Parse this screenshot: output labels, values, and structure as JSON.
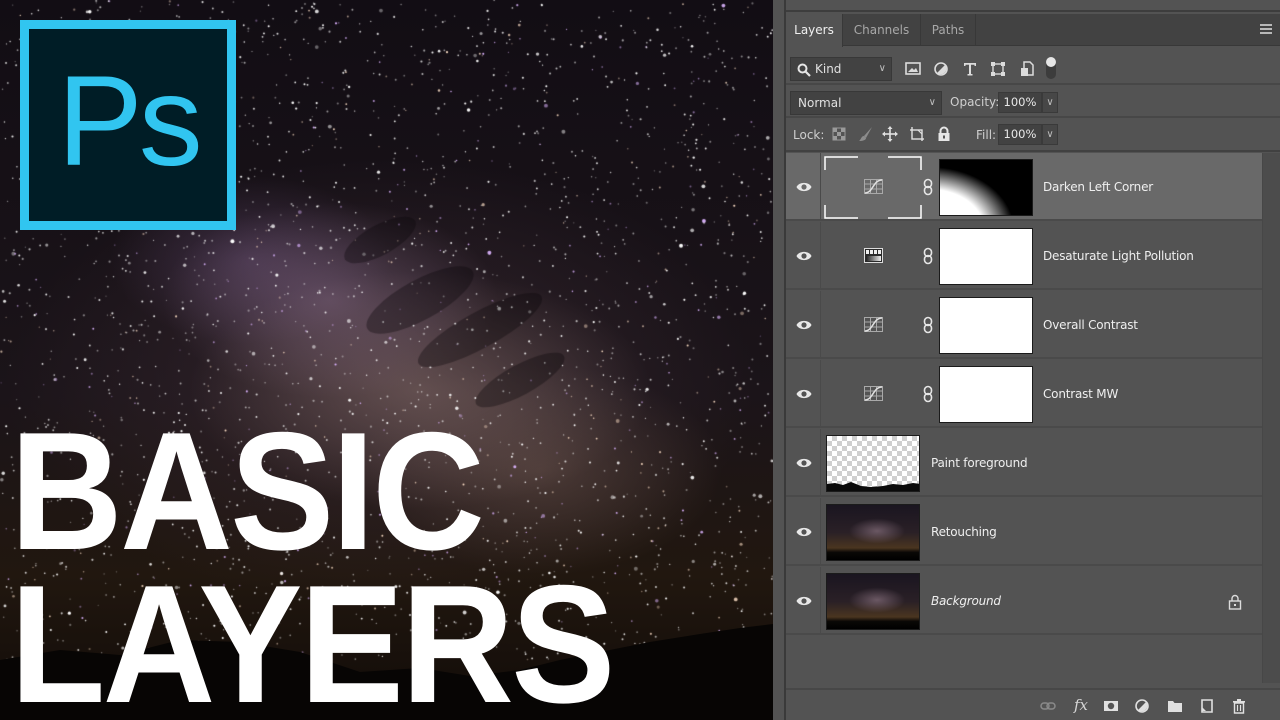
{
  "thumbnail": {
    "logo_text": "Ps",
    "title_lines": [
      "BASIC",
      "LAYERS"
    ],
    "colors": {
      "logo_accent": "#31c5f0",
      "logo_bg": "#001d26",
      "title": "#ffffff"
    }
  },
  "panel": {
    "tabs": [
      {
        "label": "Layers",
        "active": true
      },
      {
        "label": "Channels",
        "active": false
      },
      {
        "label": "Paths",
        "active": false
      }
    ],
    "menu_icon": "panel-menu-icon",
    "filter": {
      "kind_label": "Kind",
      "icons": [
        "pixel-layer-filter-icon",
        "adjustment-layer-filter-icon",
        "type-layer-filter-icon",
        "shape-layer-filter-icon",
        "smart-object-filter-icon",
        "filter-toggle-icon"
      ]
    },
    "blend": {
      "mode": "Normal",
      "opacity_label": "Opacity:",
      "opacity_value": "100%"
    },
    "lock": {
      "label": "Lock:",
      "icons": [
        "lock-transparent-pixels-icon",
        "lock-image-pixels-icon",
        "lock-position-icon",
        "lock-artboard-icon",
        "lock-all-icon"
      ],
      "fill_label": "Fill:",
      "fill_value": "100%"
    },
    "layers": [
      {
        "name": "Darken Left Corner",
        "type": "curves-adjustment",
        "visible": true,
        "selected": true,
        "mask": "gradient-corner"
      },
      {
        "name": "Desaturate Light Pollution",
        "type": "hue-saturation-adjustment",
        "visible": true,
        "selected": false,
        "mask": "white"
      },
      {
        "name": "Overall Contrast",
        "type": "curves-adjustment",
        "visible": true,
        "selected": false,
        "mask": "white"
      },
      {
        "name": "Contrast MW",
        "type": "curves-adjustment",
        "visible": true,
        "selected": false,
        "mask": "white"
      },
      {
        "name": "Paint foreground",
        "type": "pixel",
        "visible": true,
        "selected": false,
        "thumb": "transparent-with-silhouette"
      },
      {
        "name": "Retouching",
        "type": "pixel",
        "visible": true,
        "selected": false,
        "thumb": "night-sky"
      },
      {
        "name": "Background",
        "type": "pixel",
        "visible": true,
        "selected": false,
        "thumb": "night-sky",
        "locked": true,
        "italic": true
      }
    ],
    "footer_icons": [
      "link-layers-icon",
      "layer-style-fx-icon",
      "add-mask-icon",
      "new-fill-adjustment-icon",
      "new-group-icon",
      "new-layer-icon",
      "delete-layer-icon"
    ],
    "footer_fx_label": "fx"
  }
}
